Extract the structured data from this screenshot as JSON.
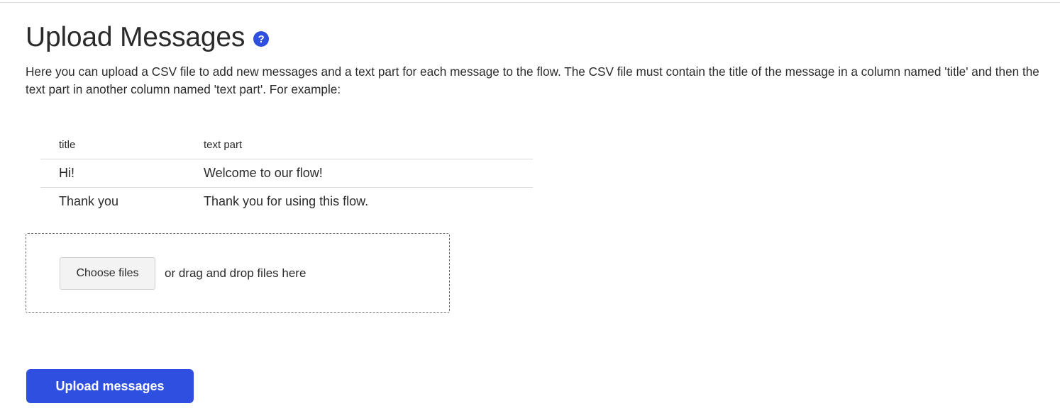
{
  "header": {
    "title": "Upload Messages",
    "help_icon": "question-circle-icon",
    "help_glyph": "?"
  },
  "intro": {
    "text": "Here you can upload a CSV file to add new messages and a text part for each message to the flow. The CSV file must contain the title of the message in a column named 'title' and then the text part in another column named 'text part'. For example:"
  },
  "example_table": {
    "columns": [
      "title",
      "text part"
    ],
    "rows": [
      [
        "Hi!",
        "Welcome to our flow!"
      ],
      [
        "Thank you",
        "Thank you for using this flow."
      ]
    ]
  },
  "dropzone": {
    "button_label": "Choose files",
    "hint": "or drag and drop files here"
  },
  "actions": {
    "upload_label": "Upload messages"
  },
  "colors": {
    "accent": "#2f4fe0",
    "text": "#2b2b2b",
    "divider": "#d9d9d9"
  }
}
